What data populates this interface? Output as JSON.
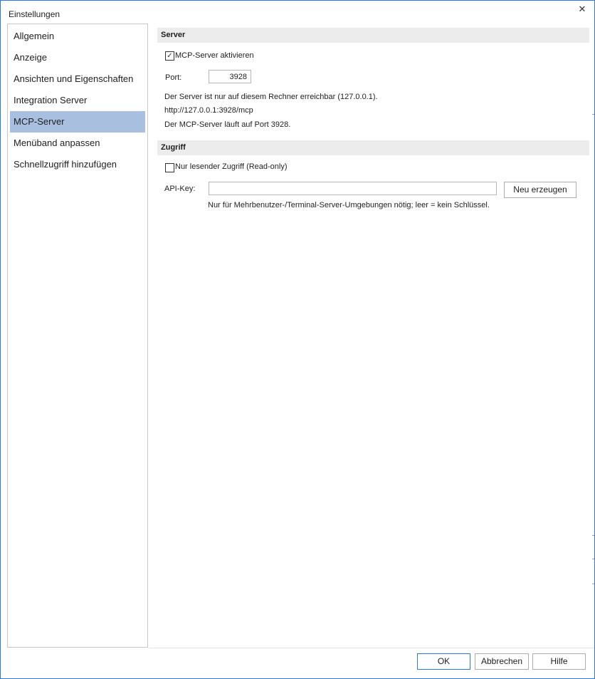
{
  "window": {
    "title": "Einstellungen",
    "close_glyph": "✕"
  },
  "sidebar": {
    "items": [
      {
        "label": "Allgemein"
      },
      {
        "label": "Anzeige"
      },
      {
        "label": "Ansichten und Eigenschaften"
      },
      {
        "label": "Integration Server"
      },
      {
        "label": "MCP-Server",
        "active": true
      },
      {
        "label": "Menüband anpassen"
      },
      {
        "label": "Schnellzugriff hinzufügen"
      }
    ]
  },
  "server_section": {
    "header": "Server",
    "enable_checkbox": {
      "label": "MCP-Server aktivieren",
      "checked": true,
      "glyph": "✓"
    },
    "port_label": "Port:",
    "port_value": "3928",
    "info_line1": "Der Server ist nur auf diesem Rechner erreichbar (127.0.0.1).",
    "info_line2": "http://127.0.0.1:3928/mcp",
    "info_line3": "Der MCP-Server läuft auf Port 3928."
  },
  "access_section": {
    "header": "Zugriff",
    "readonly_checkbox": {
      "label": "Nur lesender Zugriff (Read-only)",
      "checked": false
    },
    "api_key_label": "API-Key:",
    "api_key_value": "",
    "regenerate_button": "Neu erzeugen",
    "hint": "Nur für Mehrbenutzer-/Terminal-Server-Umgebungen nötig; leer = kein Schlüssel."
  },
  "footer": {
    "ok_button": "OK",
    "cancel_button": "Abbrechen",
    "help_button": "Hilfe"
  },
  "colors": {
    "accent": "#2b79d6",
    "nav_selected": "#a9bfe0",
    "section_header_bg": "#ececec"
  },
  "icons": {
    "close": "close-icon",
    "check": "check-icon"
  }
}
